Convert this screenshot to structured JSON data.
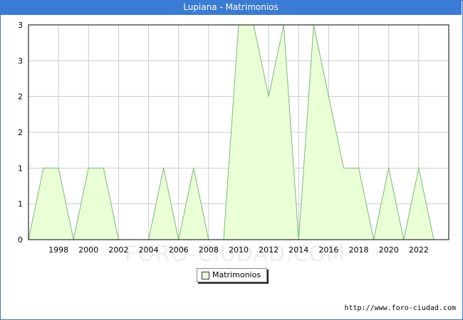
{
  "title": "Lupiana - Matrimonios",
  "watermark": "FORO-CIUDAD.COM",
  "footer": "http://www.foro-ciudad.com",
  "colors": {
    "title_bg": "#3a7bd5",
    "fill": "#eaffd6",
    "line": "#7ab97a",
    "grid": "#cccccc"
  },
  "chart_data": {
    "type": "area",
    "x": [
      1996,
      1997,
      1998,
      1999,
      2000,
      2001,
      2002,
      2003,
      2004,
      2005,
      2006,
      2007,
      2008,
      2009,
      2010,
      2011,
      2012,
      2013,
      2014,
      2015,
      2016,
      2017,
      2018,
      2019,
      2020,
      2021,
      2022,
      2023
    ],
    "series": [
      {
        "name": "Matrimonios",
        "values": [
          0,
          1,
          1,
          0,
          1,
          1,
          0,
          0,
          0,
          1,
          0,
          1,
          0,
          0,
          3,
          3,
          2,
          3,
          0,
          3,
          2,
          1,
          1,
          0,
          1,
          0,
          1,
          0
        ]
      }
    ],
    "xticks": [
      1998,
      2000,
      2002,
      2004,
      2006,
      2008,
      2010,
      2012,
      2014,
      2016,
      2018,
      2020,
      2022
    ],
    "yticks": [
      0,
      0.5,
      1,
      1.5,
      2,
      2.5,
      3
    ],
    "ytick_labels": [
      "0",
      "1",
      "1",
      "2",
      "2",
      "3",
      "3"
    ],
    "xlim": [
      1996,
      2024
    ],
    "ylim": [
      0,
      3
    ],
    "grid": true,
    "legend": "bottom-center"
  }
}
